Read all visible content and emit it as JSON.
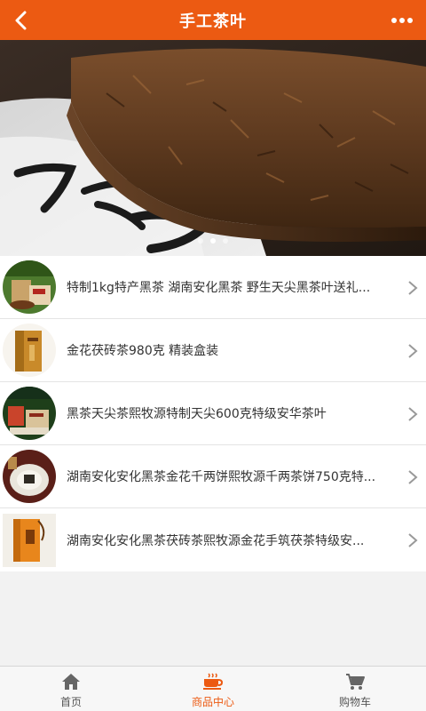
{
  "header": {
    "title": "手工茶叶",
    "back_icon": "back-arrow-icon",
    "more_icon": "more-dots-icon"
  },
  "banner": {
    "slides": 3,
    "active_slide": 2
  },
  "products": [
    {
      "name": "特制1kg特产黑茶 湖南安化黑茶 野生天尖黑茶叶送礼..."
    },
    {
      "name": "金花茯砖茶980克 精装盒装"
    },
    {
      "name": "黑茶天尖茶熙牧源特制天尖600克特级安华茶叶"
    },
    {
      "name": "湖南安化安化黑茶金花千两饼熙牧源千两茶饼750克特..."
    },
    {
      "name": "湖南安化安化黑茶茯砖茶熙牧源金花手筑茯茶特级安..."
    }
  ],
  "tabs": [
    {
      "label": "首页",
      "icon": "home-icon"
    },
    {
      "label": "商品中心",
      "icon": "tea-cup-icon"
    },
    {
      "label": "购物车",
      "icon": "cart-icon"
    }
  ],
  "colors": {
    "accent": "#ec5a12",
    "text": "#333333",
    "tab_text": "#555555"
  }
}
